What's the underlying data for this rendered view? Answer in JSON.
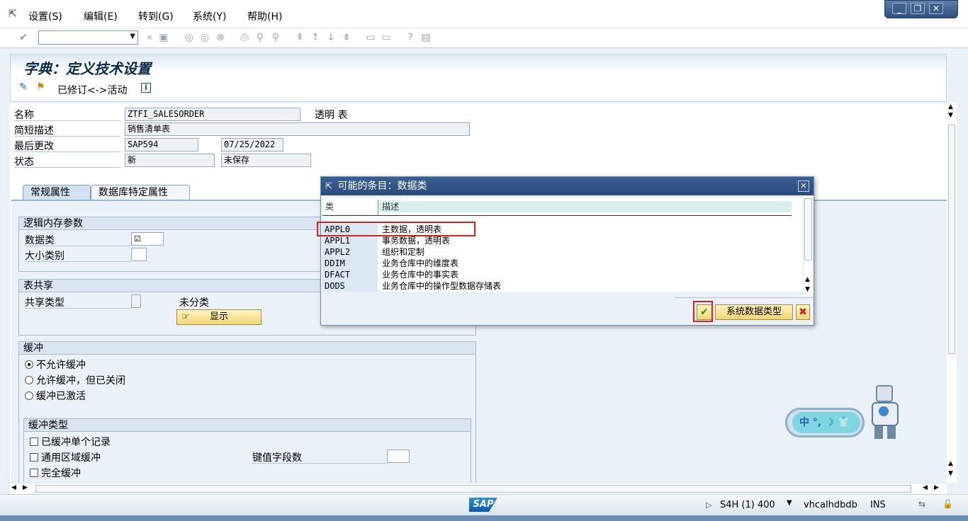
{
  "menu": [
    "设置(S)",
    "编辑(E)",
    "转到(G)",
    "系统(Y)",
    "帮助(H)"
  ],
  "window_controls": [
    "_",
    "❐",
    "✕"
  ],
  "page_title": "字典：定义技术设置",
  "app_toolbar": {
    "revised_active_label": "已修订<->活动"
  },
  "header_fields": {
    "name_label": "名称",
    "name_value": "ZTFI_SALESORDER",
    "table_type": "透明 表",
    "desc_label": "简短描述",
    "desc_value": "销售清单表",
    "last_change_label": "最后更改",
    "last_change_user": "SAP594",
    "last_change_date": "07/25/2022",
    "status_label": "状态",
    "status_value": "新",
    "save_status": "未保存"
  },
  "tabs": [
    "常规属性",
    "数据库特定属性"
  ],
  "logical_storage": {
    "title": "逻辑内存参数",
    "data_class_label": "数据类",
    "size_category_label": "大小类别"
  },
  "table_sharing": {
    "title": "表共享",
    "sharing_type_label": "共享类型",
    "unclassified": "未分类",
    "display_button": "显示"
  },
  "buffering": {
    "title": "缓冲",
    "options": [
      "不允许缓冲",
      "允许缓冲，但已关闭",
      "缓冲已激活"
    ],
    "selected": 0
  },
  "buffering_type": {
    "title": "缓冲类型",
    "options": [
      "已缓冲单个记录",
      "通用区域缓冲",
      "完全缓冲"
    ],
    "key_fields_label": "键值字段数"
  },
  "dialog": {
    "title": "可能的条目：数据类",
    "col_class": "类",
    "col_desc": "描述",
    "rows": [
      {
        "cls": "APPL0",
        "desc": "主数据，透明表"
      },
      {
        "cls": "APPL1",
        "desc": "事务数据，透明表"
      },
      {
        "cls": "APPL2",
        "desc": "组织和定制"
      },
      {
        "cls": "DDIM",
        "desc": "业务仓库中的维度表"
      },
      {
        "cls": "DFACT",
        "desc": "业务仓库中的事实表"
      },
      {
        "cls": "DODS",
        "desc": "业务仓库中的操作型数据存储表"
      }
    ],
    "system_data_types_button": "系统数据类型"
  },
  "statusbar": {
    "system": "S4H (1) 400",
    "server": "vhcalhdbdb",
    "mode": "INS"
  },
  "ime": {
    "text": "中 °, ☽ 👕"
  }
}
